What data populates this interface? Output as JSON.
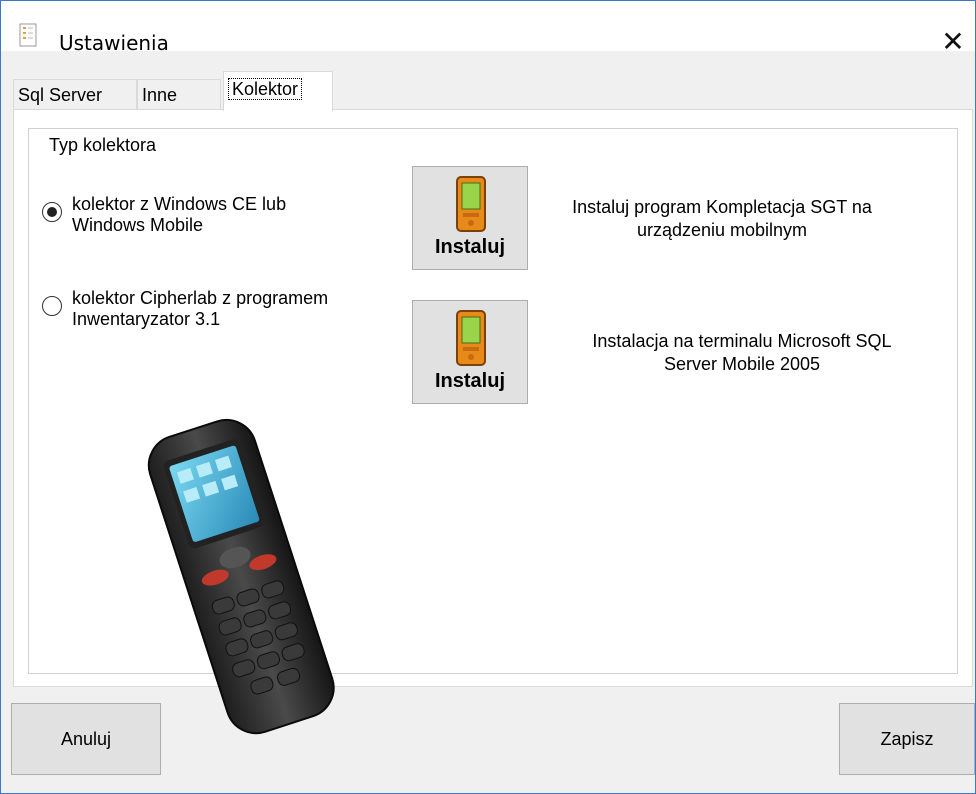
{
  "window": {
    "title": "Ustawienia"
  },
  "tabs": [
    {
      "label": "Sql Server"
    },
    {
      "label": "Inne"
    },
    {
      "label": "Kolektor"
    }
  ],
  "groupbox": {
    "legend": "Typ kolektora"
  },
  "options": [
    {
      "label_line1": "kolektor z Windows CE lub",
      "label_line2": "Windows Mobile",
      "checked": true
    },
    {
      "label_line1": "kolektor Cipherlab z programem",
      "label_line2": "Inwentaryzator 3.1",
      "checked": false
    }
  ],
  "install_buttons": [
    {
      "label": "Instaluj",
      "desc_line1": "Instaluj program Kompletacja SGT na",
      "desc_line2": "urządzeniu mobilnym"
    },
    {
      "label": "Instaluj",
      "desc_line1": "Instalacja na terminalu Microsoft SQL",
      "desc_line2": "Server Mobile 2005"
    }
  ],
  "footer": {
    "cancel_label": "Anuluj",
    "save_label": "Zapisz"
  },
  "colors": {
    "accent_border": "#3c78c8",
    "button_face": "#e1e1e1",
    "pda_orange": "#e88a1a"
  }
}
